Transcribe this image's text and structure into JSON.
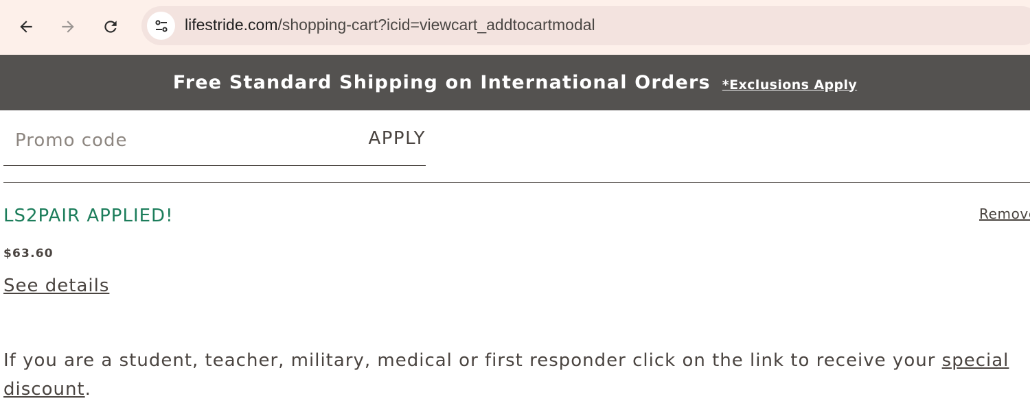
{
  "browser": {
    "url_domain": "lifestride.com",
    "url_path": "/shopping-cart?icid=viewcart_addtocartmodal",
    "icons": {
      "back": "arrow-left-icon",
      "forward": "arrow-right-icon",
      "reload": "reload-icon",
      "site_info": "tune-icon"
    }
  },
  "banner": {
    "text": "Free Standard Shipping on International Orders",
    "link": "*Exclusions Apply"
  },
  "promo": {
    "placeholder": "Promo code",
    "value": "",
    "apply_label": "APPLY"
  },
  "applied": {
    "title": "LS2PAIR APPLIED!",
    "remove_label": "Remove",
    "amount": "$63.60",
    "details_label": "See details"
  },
  "student": {
    "text": "If you are a student, teacher, military, medical or first responder click on the link to receive your ",
    "link": "special discount",
    "suffix": "."
  },
  "colors": {
    "banner_bg": "#545250",
    "applied_green": "#1c7d5b",
    "text": "#4a4440",
    "chrome_bg": "#fdf0ea",
    "omnibox_bg": "#f3e3df"
  }
}
